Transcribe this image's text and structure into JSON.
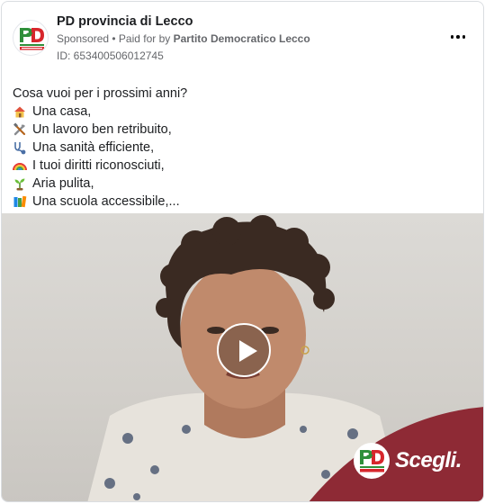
{
  "header": {
    "page_name": "PD provincia di Lecco",
    "sponsored": "Sponsored",
    "separator": " • ",
    "paid_for_prefix": "Paid for by ",
    "payer": "Partito Democratico Lecco",
    "ad_id": "ID: 653400506012745",
    "more_icon": "ellipsis-icon",
    "avatar_icon": "pd-logo-icon"
  },
  "post": {
    "lines": [
      {
        "emoji": "",
        "text": "Cosa vuoi per i prossimi anni?"
      },
      {
        "emoji": "house-emoji",
        "text": "Una casa,"
      },
      {
        "emoji": "tools-emoji",
        "text": "Un lavoro ben retribuito,"
      },
      {
        "emoji": "stethoscope-emoji",
        "text": "Una sanità efficiente,"
      },
      {
        "emoji": "rainbow-emoji",
        "text": "I tuoi diritti riconosciuti,"
      },
      {
        "emoji": "seedling-emoji",
        "text": "Aria pulita,"
      },
      {
        "emoji": "books-emoji",
        "text": "Una scuola accessibile,..."
      }
    ]
  },
  "video": {
    "play_icon": "play-icon",
    "brand_text": "Scegli.",
    "brand_logo": "pd-logo-icon",
    "colors": {
      "band": "#8e2a35",
      "play_overlay": "rgba(0,0,0,0.28)"
    }
  },
  "colors": {
    "pd_green": "#2f8f3a",
    "pd_red": "#d7262c",
    "text_primary": "#1c1e21",
    "text_secondary": "#65676b"
  }
}
